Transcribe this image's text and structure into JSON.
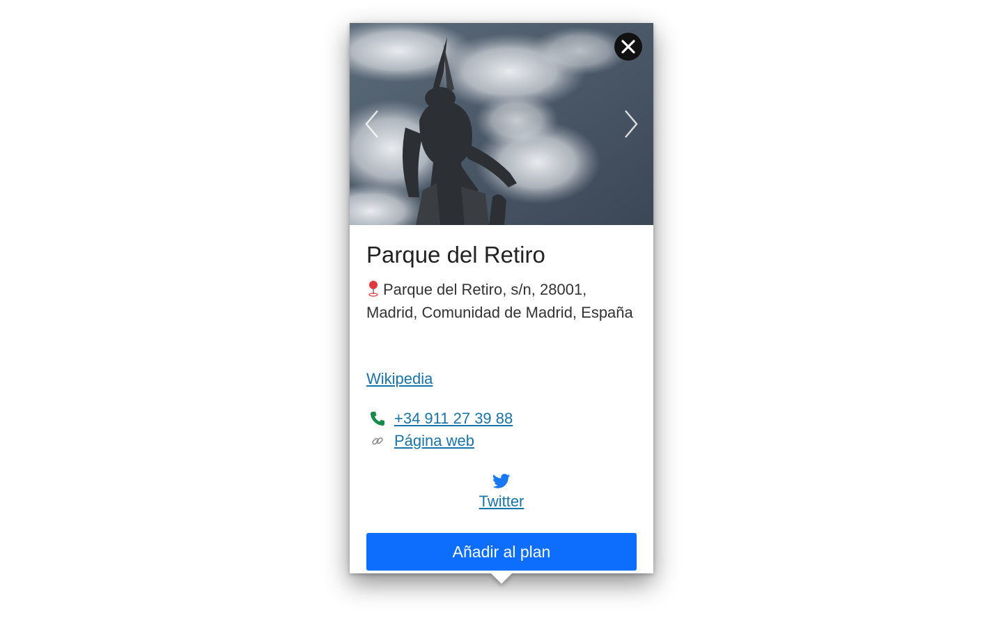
{
  "place": {
    "name": "Parque del Retiro",
    "address": "Parque del Retiro, s/n, 28001, Madrid, Comunidad de Madrid, España",
    "wikipedia_label": "Wikipedia",
    "phone": "+34 911 27 39 88",
    "website_label": "Página web",
    "twitter_label": "Twitter"
  },
  "actions": {
    "add_to_plan": "Añadir al plan"
  },
  "icons": {
    "close": "close-icon",
    "prev": "chevron-left-icon",
    "next": "chevron-right-icon",
    "pin": "map-pin-icon",
    "phone": "phone-icon",
    "link": "link-icon",
    "twitter": "twitter-icon"
  },
  "colors": {
    "link": "#1a73a8",
    "button": "#0d6efd",
    "pin": "#e03a3e",
    "phone_icon": "#1a8a4a",
    "twitter": "#1877f2"
  }
}
